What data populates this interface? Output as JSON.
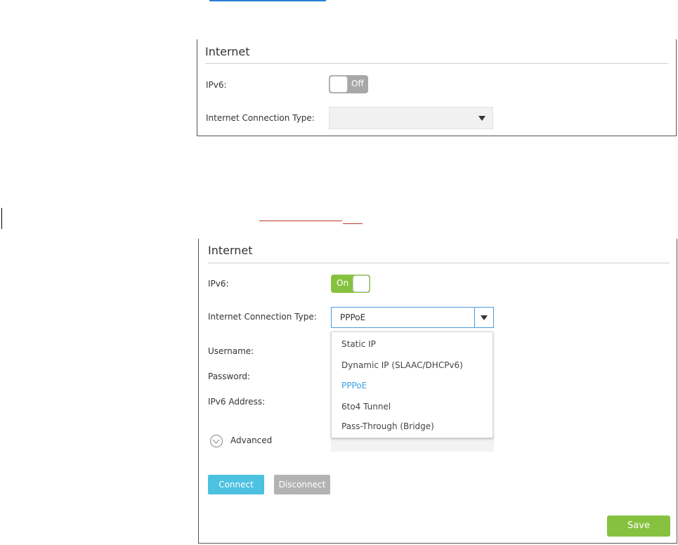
{
  "panel1": {
    "title": "Internet",
    "ipv6_label": "IPv6:",
    "ipv6_toggle": "Off",
    "conn_type_label": "Internet Connection Type:",
    "conn_type_value": ""
  },
  "panel2": {
    "title": "Internet",
    "ipv6_label": "IPv6:",
    "ipv6_toggle": "On",
    "conn_type_label": "Internet Connection Type:",
    "conn_type_value": "PPPoE",
    "username_label": "Username:",
    "password_label": "Password:",
    "ipv6_address_label": "IPv6 Address:",
    "advanced_label": "Advanced",
    "connect_label": "Connect",
    "disconnect_label": "Disconnect",
    "save_label": "Save",
    "dropdown_options": [
      "Static IP",
      "Dynamic IP (SLAAC/DHCPv6)",
      "PPPoE",
      "6to4 Tunnel",
      "Pass-Through (Bridge)"
    ],
    "selected_option": "PPPoE"
  },
  "colors": {
    "toggle_on": "#86c23f",
    "toggle_off": "#a8a8a8",
    "connect_button": "#4cc1e0",
    "save_button": "#86c23f",
    "selected_option": "#3aa0e6"
  }
}
